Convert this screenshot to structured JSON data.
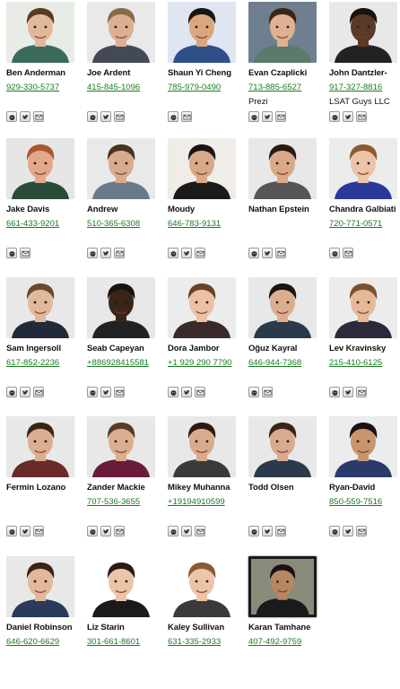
{
  "people": [
    {
      "name": "Ben Anderman",
      "phone": "929-330-5737",
      "extra": "",
      "icons": [
        "github",
        "twitter",
        "email"
      ],
      "skin": "#e2b89a",
      "hair": "#5a3a22",
      "shirt": "#3a6a5a",
      "bg": "#e8ece6"
    },
    {
      "name": "Joe Ardent",
      "phone": "415-845-1096",
      "extra": "",
      "icons": [
        "github",
        "twitter",
        "email"
      ],
      "skin": "#dcae92",
      "hair": "#8a6a44",
      "shirt": "#444a55",
      "bg": "#e9e9e9"
    },
    {
      "name": "Shaun Yi Cheng",
      "phone": "785-979-0490",
      "extra": "",
      "icons": [
        "github",
        "email"
      ],
      "skin": "#d9a67e",
      "hair": "#1a1412",
      "shirt": "#2f4f8a",
      "bg": "#dfe6f2"
    },
    {
      "name": "Evan Czaplicki",
      "phone": "713-885-6527",
      "extra": "Prezi",
      "icons": [
        "github",
        "twitter",
        "email"
      ],
      "skin": "#e0b092",
      "hair": "#3a2418",
      "shirt": "#5a7a6a",
      "bg": "#6f7f8f"
    },
    {
      "name": "John Dantzler-",
      "phone": "917-327-8816",
      "extra": "LSAT Guys LLC",
      "icons": [
        "github",
        "twitter",
        "email"
      ],
      "skin": "#5a3a28",
      "hair": "#1a1210",
      "shirt": "#222222",
      "bg": "#e8e8e8"
    },
    {
      "name": "Jake Davis",
      "phone": "661-433-9201",
      "extra": "",
      "icons": [
        "github",
        "email"
      ],
      "skin": "#e2a888",
      "hair": "#a8582e",
      "shirt": "#2a4a3a",
      "bg": "#e6e6e6"
    },
    {
      "name": "Andrew",
      "phone": "510-365-6308",
      "extra": "",
      "icons": [
        "github",
        "twitter",
        "email"
      ],
      "skin": "#d8aa8e",
      "hair": "#4a3220",
      "shirt": "#6a7a8a",
      "bg": "#e9e9e9"
    },
    {
      "name": "Moudy",
      "phone": "646-783-9131",
      "extra": "",
      "icons": [
        "github",
        "twitter",
        "email"
      ],
      "skin": "#d8a888",
      "hair": "#1a1412",
      "shirt": "#1a1a1a",
      "bg": "#f0ede8"
    },
    {
      "name": "Nathan Epstein",
      "phone": "",
      "extra": "",
      "icons": [
        "github",
        "twitter",
        "email"
      ],
      "skin": "#d8a888",
      "hair": "#2a1a12",
      "shirt": "#555555",
      "bg": "#e8e8e8"
    },
    {
      "name": "Chandra Galbiati",
      "phone": "720-771-0571",
      "extra": "",
      "icons": [
        "github",
        "email"
      ],
      "skin": "#ecc4a8",
      "hair": "#8a5a32",
      "shirt": "#2a3a9a",
      "bg": "#ececec"
    },
    {
      "name": "Sam Ingersoll",
      "phone": "617-852-2236",
      "extra": "",
      "icons": [
        "github",
        "twitter",
        "email"
      ],
      "skin": "#e2b89a",
      "hair": "#6a4a2a",
      "shirt": "#222a3a",
      "bg": "#e8e8e8"
    },
    {
      "name": "Seab Capeyan",
      "phone": "+886928415581",
      "extra": "",
      "icons": [
        "github",
        "twitter",
        "email"
      ],
      "skin": "#3a2418",
      "hair": "#1a1210",
      "shirt": "#222222",
      "bg": "#e8e8e8"
    },
    {
      "name": "Dora Jambor",
      "phone": "+1 929 290 7790",
      "extra": "",
      "icons": [
        "github",
        "twitter",
        "email"
      ],
      "skin": "#ecc0a2",
      "hair": "#6a4224",
      "shirt": "#3a2a2a",
      "bg": "#ececec"
    },
    {
      "name": "Oğuz Kayral",
      "phone": "646-944-7368",
      "extra": "",
      "icons": [
        "github",
        "email"
      ],
      "skin": "#dcae90",
      "hair": "#1a1412",
      "shirt": "#2a3a4a",
      "bg": "#e8e8e8"
    },
    {
      "name": "Lev Kravinsky",
      "phone": "215-410-6125",
      "extra": "",
      "icons": [
        "github",
        "twitter",
        "email"
      ],
      "skin": "#e6b898",
      "hair": "#7a5230",
      "shirt": "#2a2a3a",
      "bg": "#ececec"
    },
    {
      "name": "Fermin Lozano",
      "phone": "",
      "extra": "",
      "icons": [
        "github",
        "twitter",
        "email"
      ],
      "skin": "#dcae90",
      "hair": "#3a2418",
      "shirt": "#6a2a2a",
      "bg": "#e8e8e8"
    },
    {
      "name": "Zander Mackie",
      "phone": "707-536-3655",
      "extra": "",
      "icons": [
        "github",
        "twitter",
        "email"
      ],
      "skin": "#dcae90",
      "hair": "#5a3a22",
      "shirt": "#6a1a3a",
      "bg": "#e8e8e8"
    },
    {
      "name": "Mikey Muhanna",
      "phone": "+19194910599",
      "extra": "",
      "icons": [
        "github",
        "twitter",
        "email"
      ],
      "skin": "#d8aa8e",
      "hair": "#2a1a12",
      "shirt": "#3a3a3a",
      "bg": "#e8e8e8"
    },
    {
      "name": "Todd Olsen",
      "phone": "",
      "extra": "",
      "icons": [
        "github",
        "twitter",
        "email"
      ],
      "skin": "#d8aa8e",
      "hair": "#3a2418",
      "shirt": "#2a3a4a",
      "bg": "#e8e8e8"
    },
    {
      "name": "Ryan-David",
      "phone": "850-559-7516",
      "extra": "",
      "icons": [
        "github",
        "twitter",
        "email"
      ],
      "skin": "#c8966e",
      "hair": "#1a1412",
      "shirt": "#2a3a6a",
      "bg": "#ececec"
    },
    {
      "name": "Daniel Robinson",
      "phone": "646-620-6629",
      "extra": "",
      "icons": [],
      "skin": "#e2b89a",
      "hair": "#3a2418",
      "shirt": "#2a3a5a",
      "bg": "#e8e8e8"
    },
    {
      "name": "Liz Starin",
      "phone": "301-661-8601",
      "extra": "",
      "icons": [],
      "skin": "#ecc4a8",
      "hair": "#2a1a12",
      "shirt": "#1a1a1a",
      "bg": "#ffffff"
    },
    {
      "name": "Kaley Sullivan",
      "phone": "631-335-2933",
      "extra": "",
      "icons": [],
      "skin": "#ecc4a8",
      "hair": "#8a5a32",
      "shirt": "#3a3a3a",
      "bg": "#ffffff"
    },
    {
      "name": "Karan Tamhane",
      "phone": "407-492-9759",
      "extra": "",
      "icons": [],
      "skin": "#b88662",
      "hair": "#1a1210",
      "shirt": "#1a1a1a",
      "bg": "#8a8a7a",
      "framed": true
    }
  ],
  "icon_labels": {
    "github": "github-icon",
    "twitter": "twitter-icon",
    "email": "email-icon"
  },
  "colors": {
    "link": "#1b7a22",
    "name": "#111111"
  }
}
